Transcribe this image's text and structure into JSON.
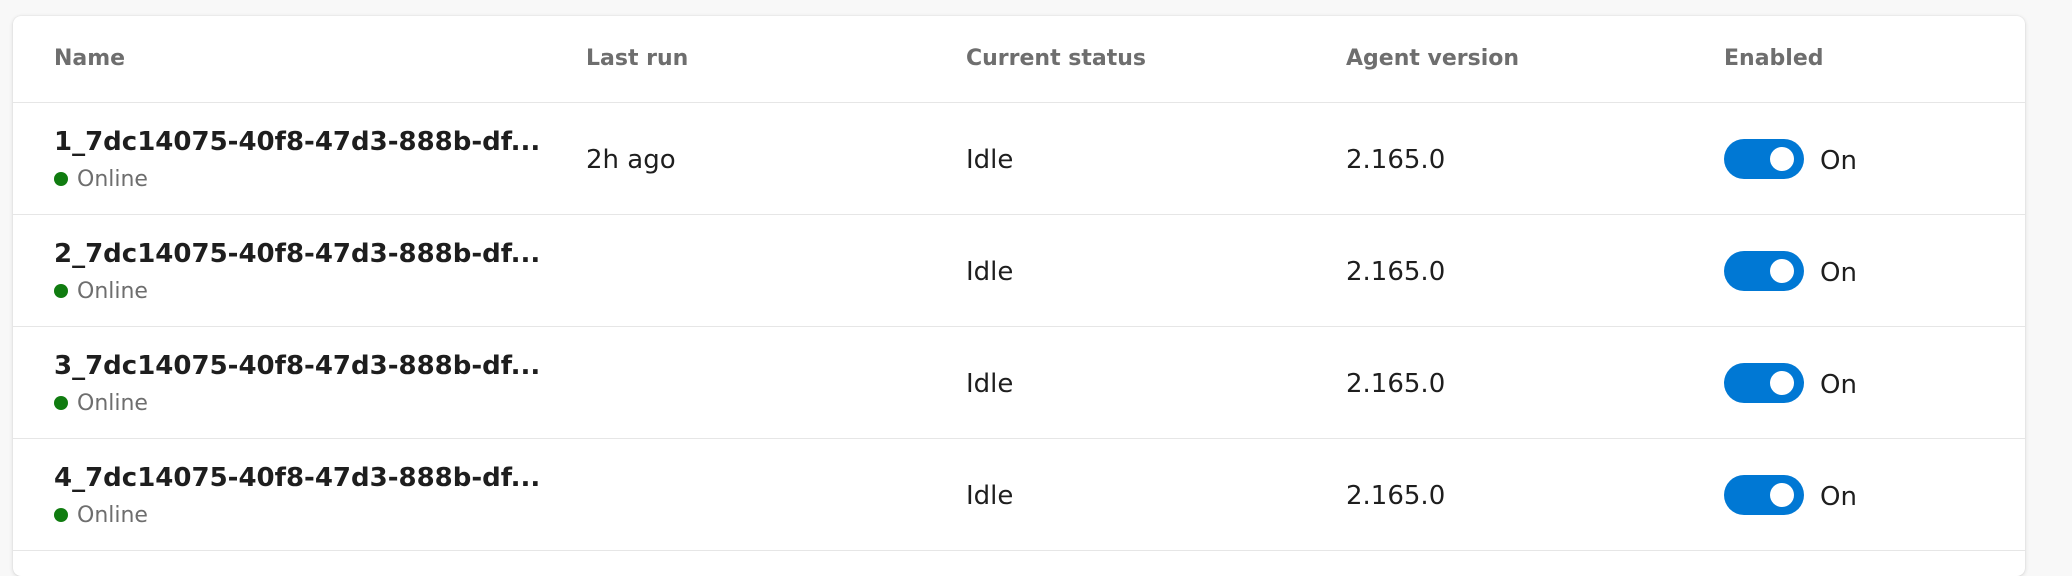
{
  "colors": {
    "accent": "#0078d4",
    "online": "#107c10"
  },
  "table": {
    "headers": {
      "name": "Name",
      "last_run": "Last run",
      "current_status": "Current status",
      "agent_version": "Agent version",
      "enabled": "Enabled"
    },
    "rows": [
      {
        "name": "1_7dc14075-40f8-47d3-888b-df...",
        "connection": "Online",
        "last_run": "2h ago",
        "status": "Idle",
        "version": "2.165.0",
        "enabled_label": "On",
        "enabled": true
      },
      {
        "name": "2_7dc14075-40f8-47d3-888b-df...",
        "connection": "Online",
        "last_run": "",
        "status": "Idle",
        "version": "2.165.0",
        "enabled_label": "On",
        "enabled": true
      },
      {
        "name": "3_7dc14075-40f8-47d3-888b-df...",
        "connection": "Online",
        "last_run": "",
        "status": "Idle",
        "version": "2.165.0",
        "enabled_label": "On",
        "enabled": true
      },
      {
        "name": "4_7dc14075-40f8-47d3-888b-df...",
        "connection": "Online",
        "last_run": "",
        "status": "Idle",
        "version": "2.165.0",
        "enabled_label": "On",
        "enabled": true
      }
    ]
  }
}
